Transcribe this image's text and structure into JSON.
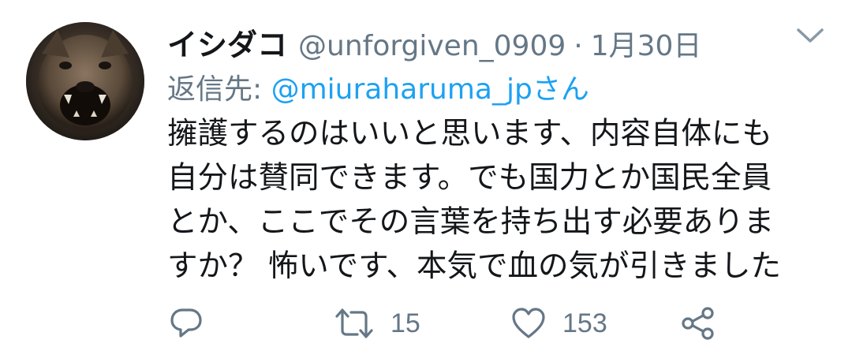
{
  "tweet": {
    "author": {
      "display_name": "イシダコ",
      "handle": "@unforgiven_0909",
      "separator": "·",
      "date": "1月30日"
    },
    "reply_to": {
      "prefix": "返信先: ",
      "handle": "@miuraharuma_jp",
      "suffix": "さん"
    },
    "body_lines": [
      "擁護するのはいいと思います、内容自体にも",
      "自分は賛同できます。でも国力とか国民全員",
      "とか、ここでその言葉を持ち出す必要ありま",
      "すか？ 怖いです、本気で血の気が引きました"
    ],
    "actions": {
      "reply": {
        "icon": "reply-icon",
        "count": ""
      },
      "retweet": {
        "icon": "retweet-icon",
        "count": "15"
      },
      "like": {
        "icon": "heart-icon",
        "count": "153"
      },
      "share": {
        "icon": "share-icon"
      }
    },
    "menu_icon": "chevron-down-icon",
    "colors": {
      "text_primary": "#14171a",
      "text_secondary": "#657786",
      "link": "#1da1f2",
      "icon": "#657786"
    }
  }
}
